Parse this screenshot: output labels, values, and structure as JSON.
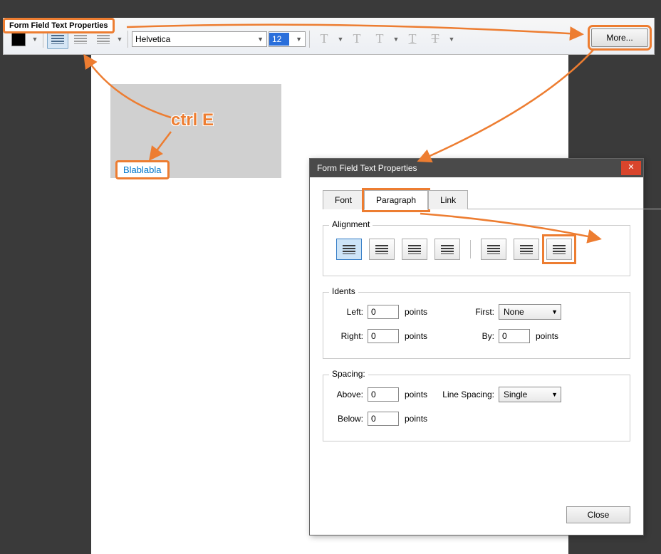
{
  "toolbar_label": "Form Field Text Properties",
  "font": "Helvetica",
  "size": "12",
  "more": "More...",
  "ctrle": "ctrl E",
  "sample_text": "Blablabla",
  "dialog": {
    "title": "Form Field Text Properties",
    "tabs": {
      "font": "Font",
      "paragraph": "Paragraph",
      "link": "Link"
    },
    "alignment": "Alignment",
    "indents": "Idents",
    "left_lbl": "Left:",
    "right_lbl": "Right:",
    "first_lbl": "First:",
    "by_lbl": "By:",
    "first_val": "None",
    "points": "points",
    "zero": "0",
    "spacing": "Spacing:",
    "above": "Above:",
    "below": "Below:",
    "linespacing_lbl": "Line Spacing:",
    "linespacing_val": "Single",
    "close": "Close"
  }
}
